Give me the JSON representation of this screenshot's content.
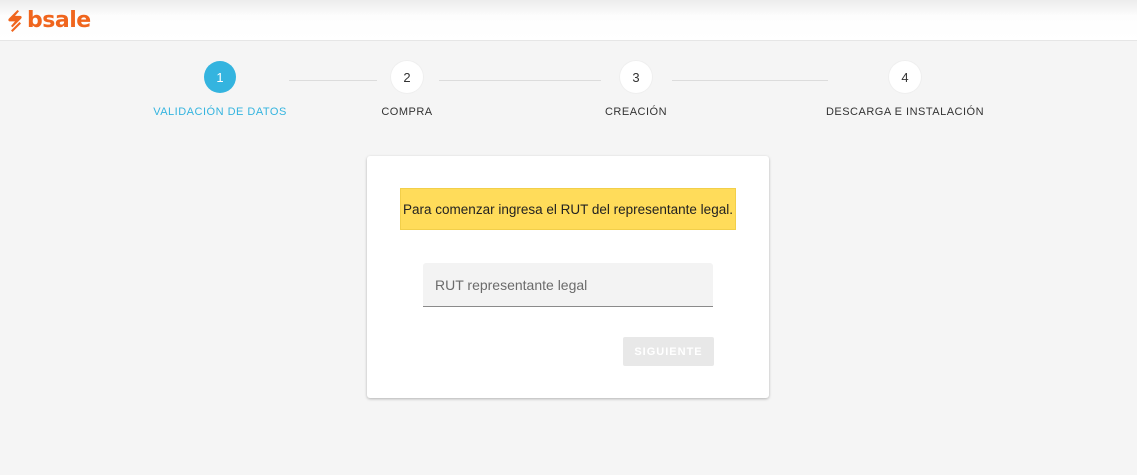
{
  "header": {
    "logo_text": "bsale",
    "logo_icon": "bsale-logo-icon",
    "brand_color": "#f0651d"
  },
  "stepper": {
    "active_color": "#34b4df",
    "steps": [
      {
        "number": "1",
        "label": "Validación de datos",
        "active": true
      },
      {
        "number": "2",
        "label": "Compra",
        "active": false
      },
      {
        "number": "3",
        "label": "Creación",
        "active": false
      },
      {
        "number": "4",
        "label": "Descarga e instalación",
        "active": false
      }
    ]
  },
  "form": {
    "notice": "Para comenzar ingresa el RUT del representante legal.",
    "notice_color": "#ffdc5a",
    "rut_input": {
      "placeholder": "RUT representante legal",
      "value": ""
    },
    "next_button_label": "SIGUIENTE",
    "next_button_disabled": true
  }
}
